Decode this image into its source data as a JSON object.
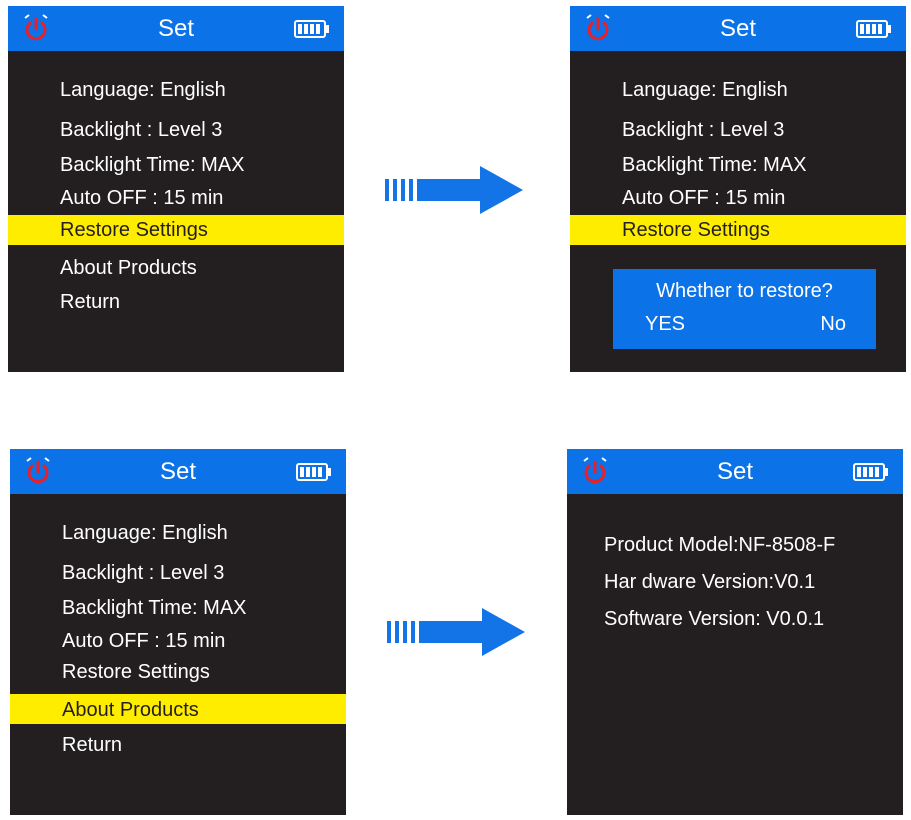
{
  "screens": [
    {
      "title": "Set",
      "items": [
        "Language: English",
        "Backlight : Level 3",
        "Backlight Time: MAX",
        "Auto OFF : 15 min",
        "Restore Settings",
        "About Products",
        "Return"
      ],
      "selected_index": 4
    },
    {
      "title": "Set",
      "items": [
        "Language: English",
        "Backlight : Level 3",
        "Backlight Time: MAX",
        "Auto OFF : 15 min",
        "Restore Settings"
      ],
      "selected_index": 4,
      "dialog": {
        "question": "Whether to restore?",
        "yes": "YES",
        "no": "No"
      }
    },
    {
      "title": "Set",
      "items": [
        "Language: English",
        "Backlight : Level 3",
        "Backlight Time: MAX",
        "Auto OFF : 15 min",
        "Restore Settings",
        "About Products",
        "Return"
      ],
      "selected_index": 5
    },
    {
      "title": "Set",
      "info": [
        "Product Model:NF-8508-F",
        "Har dware Version:V0.1",
        "Software Version: V0.0.1"
      ]
    }
  ],
  "icons": {
    "header_left": "power-icon",
    "header_right": "battery-icon",
    "transition": "arrow-right-icon"
  },
  "colors": {
    "header": "#0b72e7",
    "screen_bg": "#231f20",
    "highlight": "#ffed00",
    "power_icon": "#e8202a",
    "arrow": "#1274e6"
  }
}
